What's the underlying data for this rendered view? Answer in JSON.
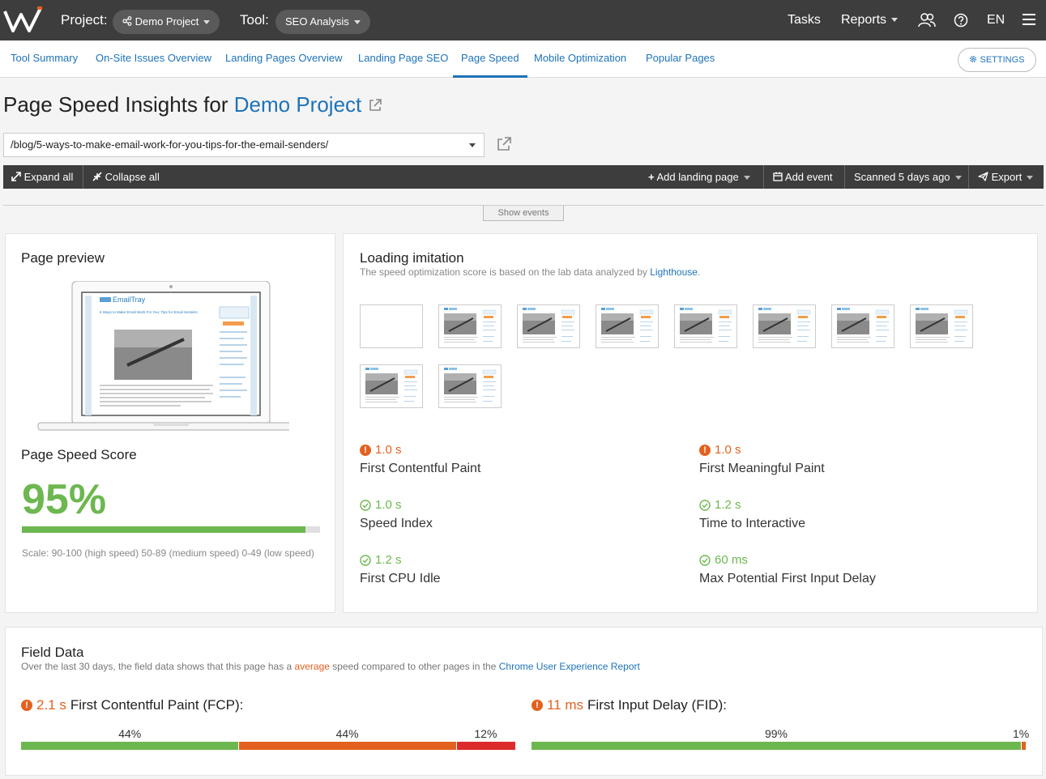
{
  "topbar": {
    "project_label": "Project:",
    "project_value": "Demo Project",
    "tool_label": "Tool:",
    "tool_value": "SEO Analysis",
    "tasks": "Tasks",
    "reports": "Reports",
    "lang": "EN"
  },
  "tabs": [
    {
      "label": "Tool Summary"
    },
    {
      "label": "On-Site Issues Overview"
    },
    {
      "label": "Landing Pages Overview"
    },
    {
      "label": "Landing Page SEO"
    },
    {
      "label": "Page Speed",
      "active": true
    },
    {
      "label": "Mobile Optimization"
    },
    {
      "label": "Popular Pages"
    }
  ],
  "settings_label": "SETTINGS",
  "page": {
    "title_prefix": "Page Speed Insights for",
    "title_project": "Demo Project",
    "url_value": "/blog/5-ways-to-make-email-work-for-you-tips-for-the-email-senders/"
  },
  "actions": {
    "expand_all": "Expand all",
    "collapse_all": "Collapse all",
    "add_landing_page": "Add landing page",
    "add_event": "Add event",
    "scanned": "Scanned 5 days ago",
    "export": "Export",
    "show_events": "Show events"
  },
  "preview": {
    "title": "Page preview",
    "score_title": "Page Speed Score",
    "score_value": "95%",
    "score_fraction": 0.95,
    "scale_note": "Scale: 90-100 (high speed) 50-89 (medium speed) 0-49 (low speed)",
    "site_logo": "EmailTray",
    "site_headline": "5 Ways to Make Email Work For You: Tips for Email Senders"
  },
  "loading": {
    "title": "Loading imitation",
    "subtitle": "The speed optimization score is based on the lab data analyzed by",
    "subtitle_link": "Lighthouse",
    "subtitle_end": ".",
    "frames": 10,
    "metrics": [
      {
        "value": "1.0 s",
        "name": "First Contentful Paint",
        "status": "warn"
      },
      {
        "value": "1.0 s",
        "name": "First Meaningful Paint",
        "status": "warn"
      },
      {
        "value": "1.0 s",
        "name": "Speed Index",
        "status": "good"
      },
      {
        "value": "1.2 s",
        "name": "Time to Interactive",
        "status": "good"
      },
      {
        "value": "1.2 s",
        "name": "First CPU Idle",
        "status": "good"
      },
      {
        "value": "60 ms",
        "name": "Max Potential First Input Delay",
        "status": "good"
      }
    ]
  },
  "field": {
    "title": "Field Data",
    "sub_pre": "Over the last 30 days, the field data shows that this page has a",
    "sub_avg": "average",
    "sub_mid": "speed compared to other pages in the",
    "sub_link": "Chrome User Experience Report",
    "fcp": {
      "value": "2.1 s",
      "name": "First Contentful Paint (FCP):",
      "dist": [
        44,
        44,
        12
      ],
      "labels": [
        "44%",
        "44%",
        "12%"
      ]
    },
    "fid": {
      "value": "11 ms",
      "name": "First Input Delay (FID):",
      "dist": [
        99,
        1
      ],
      "labels": [
        "99%",
        "1%"
      ]
    }
  },
  "colors": {
    "good": "#6db750",
    "medium": "#e3611f",
    "bad": "#dd2a2a",
    "link": "#1e73b8",
    "topbar": "#3d3d3d"
  }
}
